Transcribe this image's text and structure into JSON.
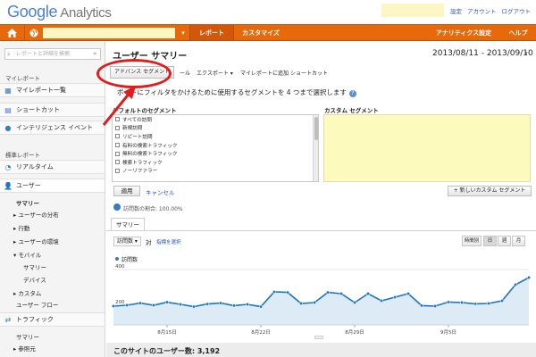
{
  "header": {
    "logo_google": "Google",
    "logo_product": "Analytics",
    "links": [
      "設定",
      "アカウント",
      "ログアウト"
    ]
  },
  "nav": {
    "home_icon": "home-icon",
    "globe_icon": "globe-icon",
    "report": "レポート",
    "customize": "カスタマイズ",
    "admin": "アナリティクス設定",
    "help": "ヘルプ"
  },
  "sidebar": {
    "search_placeholder": "レポートと詳細を検索",
    "my_reports_section": "マイレポート",
    "my_reports_list": "マイレポート一覧",
    "shortcuts": "ショートカット",
    "intelligence": "インテリジェンス イベント",
    "standard_section": "標準レポート",
    "realtime": "リアルタイム",
    "users": "ユーザー",
    "summary": "サマリー",
    "distribution": "ユーザーの分布",
    "behavior": "行動",
    "environment": "ユーザーの環境",
    "mobile": "モバイル",
    "mobile_summary": "サマリー",
    "devices": "デバイス",
    "custom": "カスタム",
    "user_flow": "ユーザー フロー",
    "traffic": "トラフィック",
    "traffic_summary": "サマリー",
    "referrals": "参照元"
  },
  "main": {
    "title": "ユーザー サマリー",
    "date_range": "2013/08/11 - 2013/09/10",
    "toolbar": {
      "advanced_segments": "アドバンス セグメント",
      "mail_suffix": "ール",
      "export": "エクスポート",
      "add_to_my_reports": "マイレポートに追加",
      "shortcut": "ショートカット"
    },
    "segment_prompt": "ポートにフィルタをかけるために使用するセグメントを 4 つまで選択します",
    "default_segments_header": "デフォルトのセグメント",
    "custom_segments_header": "カスタム セグメント",
    "default_segments": [
      "すべての訪問",
      "新規訪問",
      "リピート訪問",
      "有料の検索トラフィック",
      "無料の検索トラフィック",
      "検索トラフィック",
      "ノーリファラー"
    ],
    "apply": "適用",
    "cancel": "キャンセル",
    "new_custom_segment": "+ 新しいカスタム セグメント",
    "sample_text": "訪問数の割合: 100.00%",
    "summary_tab": "サマリー",
    "metric_select": "訪問数",
    "vs": "対",
    "select_metric": "指標を選択",
    "graph_buttons": [
      "時間別",
      "日",
      "週",
      "月"
    ],
    "legend": "訪問数",
    "users_banner": "このサイトのユーザー数: 3,192"
  },
  "chart_data": {
    "type": "area",
    "series": [
      {
        "name": "訪問数",
        "values": [
          195,
          200,
          212,
          200,
          217,
          205,
          192,
          207,
          212,
          198,
          205,
          192,
          275,
          272,
          210,
          215,
          272,
          265,
          215,
          265,
          225,
          245,
          265,
          198,
          195,
          218,
          215,
          208,
          210,
          225,
          315,
          355
        ]
      }
    ],
    "x_ticks": [
      "8月15日",
      "8月22日",
      "8月29日",
      "9月5日"
    ],
    "y_ticks": [
      200,
      400
    ],
    "ylim": [
      90,
      430
    ],
    "line_color": "#1e75bb",
    "fill_color": "#dcebf6"
  }
}
